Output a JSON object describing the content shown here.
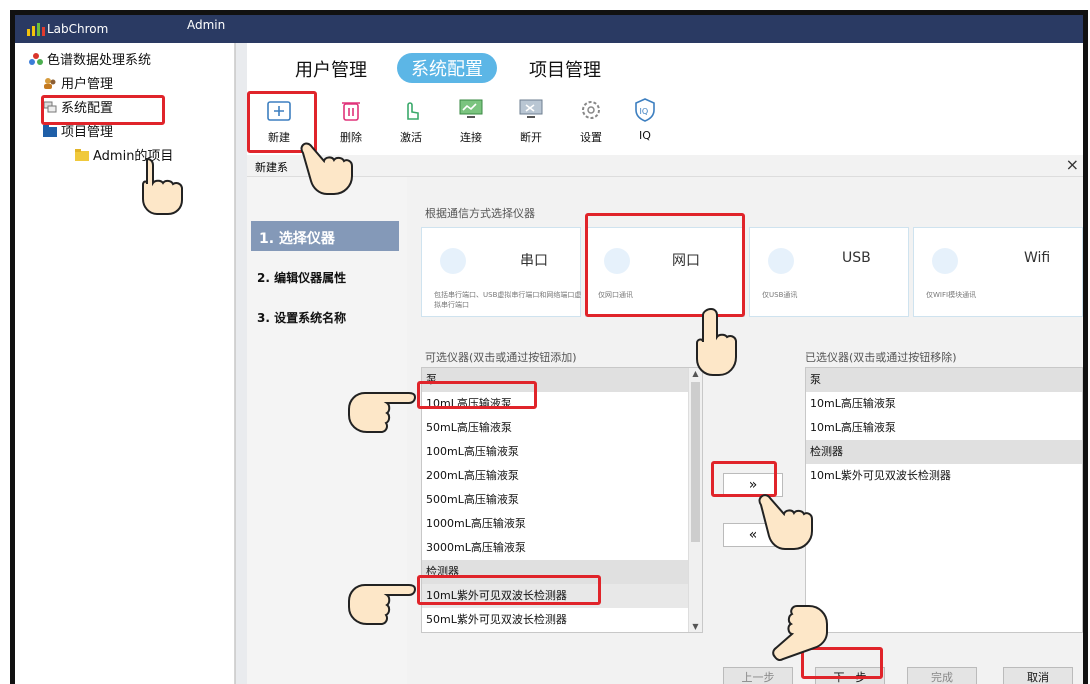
{
  "window": {
    "app_title": "LabChrom",
    "user": "Admin"
  },
  "sidebar": {
    "items": [
      {
        "label": "色谱数据处理系统"
      },
      {
        "label": "用户管理"
      },
      {
        "label": "系统配置"
      },
      {
        "label": "项目管理"
      },
      {
        "label": "Admin的项目"
      }
    ]
  },
  "tabs": [
    {
      "label": "用户管理"
    },
    {
      "label": "系统配置",
      "active": true
    },
    {
      "label": "项目管理"
    }
  ],
  "toolbar": [
    {
      "label": "新建",
      "icon": "folder-plus-icon"
    },
    {
      "label": "删除",
      "icon": "trash-icon"
    },
    {
      "label": "激活",
      "icon": "hand-pointer-icon"
    },
    {
      "label": "连接",
      "icon": "monitor-connect-icon"
    },
    {
      "label": "断开",
      "icon": "monitor-disconnect-icon"
    },
    {
      "label": "设置",
      "icon": "gear-icon"
    },
    {
      "label": "IQ",
      "icon": "iq-icon"
    }
  ],
  "dialog": {
    "title": "新建系",
    "close": "×",
    "steps": [
      {
        "label": "1. 选择仪器"
      },
      {
        "label": "2. 编辑仪器属性"
      },
      {
        "label": "3. 设置系统名称"
      }
    ],
    "comm_section_label": "根据通信方式选择仪器",
    "comm_options": [
      {
        "title": "串口",
        "desc": "包括串行端口、USB虚拟串行端口和网络端口虚拟串行端口"
      },
      {
        "title": "网口",
        "desc": "仅网口通讯"
      },
      {
        "title": "USB",
        "desc": "仅USB通讯"
      },
      {
        "title": "Wifi",
        "desc": "仅WIFI模块通讯"
      }
    ],
    "available_label": "可选仪器(双击或通过按钮添加)",
    "selected_label": "已选仪器(双击或通过按钮移除)",
    "available": [
      {
        "text": "泵",
        "group": true
      },
      {
        "text": "10mL高压输液泵"
      },
      {
        "text": "50mL高压输液泵"
      },
      {
        "text": "100mL高压输液泵"
      },
      {
        "text": "200mL高压输液泵"
      },
      {
        "text": "500mL高压输液泵"
      },
      {
        "text": "1000mL高压输液泵"
      },
      {
        "text": "3000mL高压输液泵"
      },
      {
        "text": "检测器",
        "group": true
      },
      {
        "text": "10mL紫外可见双波长检测器"
      },
      {
        "text": "50mL紫外可见双波长检测器"
      }
    ],
    "selected": [
      {
        "text": "泵",
        "group": true
      },
      {
        "text": "10mL高压输液泵"
      },
      {
        "text": "10mL高压输液泵"
      },
      {
        "text": "检测器",
        "group": true
      },
      {
        "text": "10mL紫外可见双波长检测器"
      }
    ],
    "add_btn": "»",
    "remove_btn": "«",
    "footer": {
      "prev": "上一步",
      "next": "下一步",
      "finish": "完成",
      "cancel": "取消"
    }
  },
  "colors": {
    "titlebar": "#2a3a63",
    "active_tab": "#5cb6e6",
    "active_step": "#8499b8",
    "highlight": "#e0242a"
  }
}
